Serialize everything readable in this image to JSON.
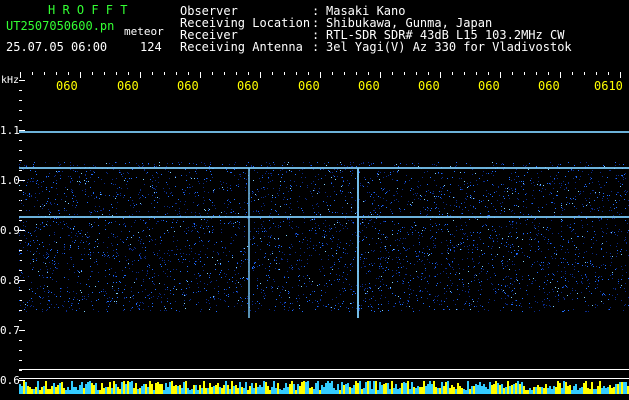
{
  "header": {
    "app_name": "H R O F F T",
    "file_name": "UT2507050600.pn",
    "meteor_label": "meteor",
    "date_time": "25.07.05 06:00",
    "count": "124",
    "fields": [
      {
        "label": "Observer",
        "sep": ":",
        "value": "Masaki Kano"
      },
      {
        "label": "Receiving Location",
        "sep": ":",
        "value": "Shibukawa, Gunma, Japan"
      },
      {
        "label": "Receiver",
        "sep": ":",
        "value": "RTL-SDR SDR# 43dB L15 103.2MHz CW"
      },
      {
        "label": "Receiving Antenna",
        "sep": ":",
        "value": "3el Yagi(V) Az 330 for Vladivostok"
      }
    ]
  },
  "axes": {
    "y_unit": "kHz",
    "y_ticks": [
      "1.1",
      "1.0",
      "0.9",
      "0.8",
      "0.7",
      "0.6"
    ],
    "x_ticks": [
      "060",
      "060",
      "060",
      "060",
      "060",
      "060",
      "060",
      "060",
      "060",
      "0610"
    ]
  },
  "colors": {
    "background": "#000000",
    "text": "#ffffff",
    "title": "#33ff33",
    "time_labels": "#ffff00",
    "signal_low": "#0a2a8a",
    "signal_mid": "#1e6bff",
    "signal_high": "#7fd0ff"
  }
}
